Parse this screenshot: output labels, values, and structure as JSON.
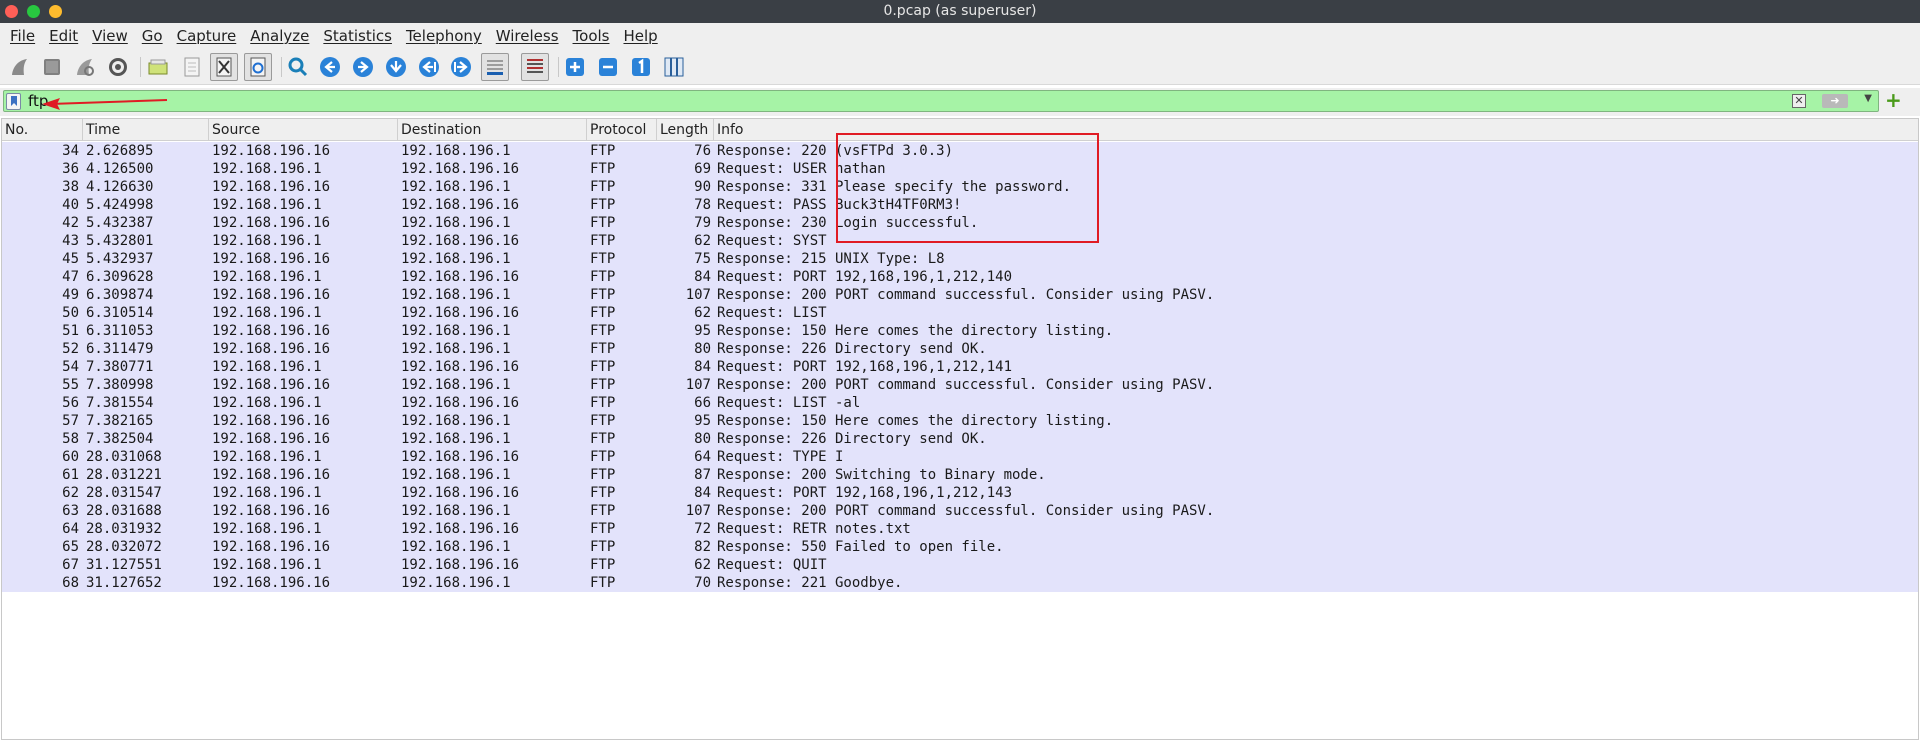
{
  "window": {
    "title": "0.pcap (as superuser)"
  },
  "menu": [
    "File",
    "Edit",
    "View",
    "Go",
    "Capture",
    "Analyze",
    "Statistics",
    "Telephony",
    "Wireless",
    "Tools",
    "Help"
  ],
  "toolbar": {
    "icons": [
      "start-capture-icon",
      "stop-capture-icon",
      "restart-capture-icon",
      "capture-options-icon",
      "open-file-icon",
      "save-file-icon",
      "close-file-icon",
      "reload-file-icon",
      "find-packet-icon",
      "go-back-icon",
      "go-forward-icon",
      "go-to-packet-icon",
      "go-first-icon",
      "go-last-icon",
      "auto-scroll-icon",
      "colorize-icon",
      "zoom-in-icon",
      "zoom-out-icon",
      "normal-size-icon",
      "resize-columns-icon"
    ]
  },
  "filter": {
    "value": "ftp",
    "accent": "#a6f3a6"
  },
  "annotation": {
    "color": "#e01b24"
  },
  "columns": {
    "no": "No.",
    "time": "Time",
    "source": "Source",
    "destination": "Destination",
    "protocol": "Protocol",
    "length": "Length",
    "info": "Info"
  },
  "row_color": "#e3e3fb",
  "packets": [
    {
      "no": "34",
      "time": "2.626895",
      "src": "192.168.196.16",
      "dst": "192.168.196.1",
      "proto": "FTP",
      "len": "76",
      "info": "Response: 220 (vsFTPd 3.0.3)"
    },
    {
      "no": "36",
      "time": "4.126500",
      "src": "192.168.196.1",
      "dst": "192.168.196.16",
      "proto": "FTP",
      "len": "69",
      "info": "Request: USER nathan"
    },
    {
      "no": "38",
      "time": "4.126630",
      "src": "192.168.196.16",
      "dst": "192.168.196.1",
      "proto": "FTP",
      "len": "90",
      "info": "Response: 331 Please specify the password."
    },
    {
      "no": "40",
      "time": "5.424998",
      "src": "192.168.196.1",
      "dst": "192.168.196.16",
      "proto": "FTP",
      "len": "78",
      "info": "Request: PASS Buck3tH4TF0RM3!"
    },
    {
      "no": "42",
      "time": "5.432387",
      "src": "192.168.196.16",
      "dst": "192.168.196.1",
      "proto": "FTP",
      "len": "79",
      "info": "Response: 230 Login successful."
    },
    {
      "no": "43",
      "time": "5.432801",
      "src": "192.168.196.1",
      "dst": "192.168.196.16",
      "proto": "FTP",
      "len": "62",
      "info": "Request: SYST"
    },
    {
      "no": "45",
      "time": "5.432937",
      "src": "192.168.196.16",
      "dst": "192.168.196.1",
      "proto": "FTP",
      "len": "75",
      "info": "Response: 215 UNIX Type: L8"
    },
    {
      "no": "47",
      "time": "6.309628",
      "src": "192.168.196.1",
      "dst": "192.168.196.16",
      "proto": "FTP",
      "len": "84",
      "info": "Request: PORT 192,168,196,1,212,140"
    },
    {
      "no": "49",
      "time": "6.309874",
      "src": "192.168.196.16",
      "dst": "192.168.196.1",
      "proto": "FTP",
      "len": "107",
      "info": "Response: 200 PORT command successful. Consider using PASV."
    },
    {
      "no": "50",
      "time": "6.310514",
      "src": "192.168.196.1",
      "dst": "192.168.196.16",
      "proto": "FTP",
      "len": "62",
      "info": "Request: LIST"
    },
    {
      "no": "51",
      "time": "6.311053",
      "src": "192.168.196.16",
      "dst": "192.168.196.1",
      "proto": "FTP",
      "len": "95",
      "info": "Response: 150 Here comes the directory listing."
    },
    {
      "no": "52",
      "time": "6.311479",
      "src": "192.168.196.16",
      "dst": "192.168.196.1",
      "proto": "FTP",
      "len": "80",
      "info": "Response: 226 Directory send OK."
    },
    {
      "no": "54",
      "time": "7.380771",
      "src": "192.168.196.1",
      "dst": "192.168.196.16",
      "proto": "FTP",
      "len": "84",
      "info": "Request: PORT 192,168,196,1,212,141"
    },
    {
      "no": "55",
      "time": "7.380998",
      "src": "192.168.196.16",
      "dst": "192.168.196.1",
      "proto": "FTP",
      "len": "107",
      "info": "Response: 200 PORT command successful. Consider using PASV."
    },
    {
      "no": "56",
      "time": "7.381554",
      "src": "192.168.196.1",
      "dst": "192.168.196.16",
      "proto": "FTP",
      "len": "66",
      "info": "Request: LIST -al"
    },
    {
      "no": "57",
      "time": "7.382165",
      "src": "192.168.196.16",
      "dst": "192.168.196.1",
      "proto": "FTP",
      "len": "95",
      "info": "Response: 150 Here comes the directory listing."
    },
    {
      "no": "58",
      "time": "7.382504",
      "src": "192.168.196.16",
      "dst": "192.168.196.1",
      "proto": "FTP",
      "len": "80",
      "info": "Response: 226 Directory send OK."
    },
    {
      "no": "60",
      "time": "28.031068",
      "src": "192.168.196.1",
      "dst": "192.168.196.16",
      "proto": "FTP",
      "len": "64",
      "info": "Request: TYPE I"
    },
    {
      "no": "61",
      "time": "28.031221",
      "src": "192.168.196.16",
      "dst": "192.168.196.1",
      "proto": "FTP",
      "len": "87",
      "info": "Response: 200 Switching to Binary mode."
    },
    {
      "no": "62",
      "time": "28.031547",
      "src": "192.168.196.1",
      "dst": "192.168.196.16",
      "proto": "FTP",
      "len": "84",
      "info": "Request: PORT 192,168,196,1,212,143"
    },
    {
      "no": "63",
      "time": "28.031688",
      "src": "192.168.196.16",
      "dst": "192.168.196.1",
      "proto": "FTP",
      "len": "107",
      "info": "Response: 200 PORT command successful. Consider using PASV."
    },
    {
      "no": "64",
      "time": "28.031932",
      "src": "192.168.196.1",
      "dst": "192.168.196.16",
      "proto": "FTP",
      "len": "72",
      "info": "Request: RETR notes.txt"
    },
    {
      "no": "65",
      "time": "28.032072",
      "src": "192.168.196.16",
      "dst": "192.168.196.1",
      "proto": "FTP",
      "len": "82",
      "info": "Response: 550 Failed to open file."
    },
    {
      "no": "67",
      "time": "31.127551",
      "src": "192.168.196.1",
      "dst": "192.168.196.16",
      "proto": "FTP",
      "len": "62",
      "info": "Request: QUIT"
    },
    {
      "no": "68",
      "time": "31.127652",
      "src": "192.168.196.16",
      "dst": "192.168.196.1",
      "proto": "FTP",
      "len": "70",
      "info": "Response: 221 Goodbye."
    }
  ]
}
